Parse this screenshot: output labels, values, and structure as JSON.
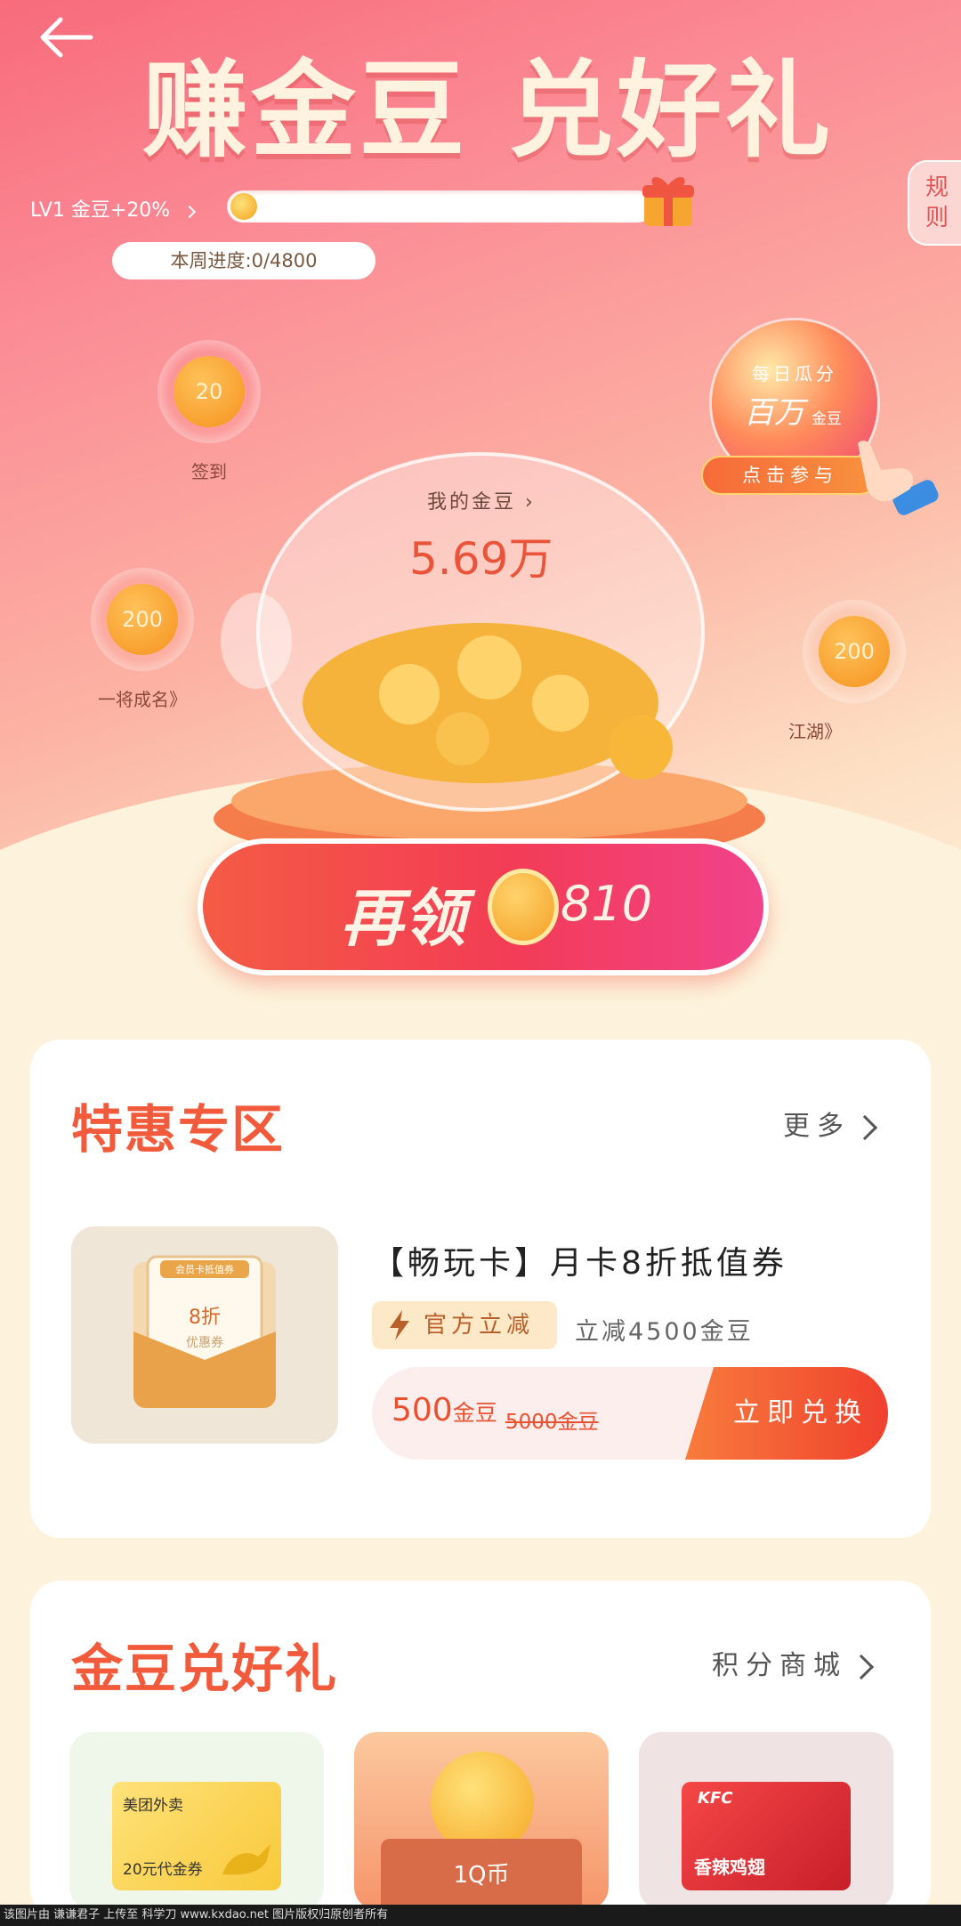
{
  "header": {
    "back_icon": "arrow-left-icon",
    "headline": "赚金豆 兑好礼",
    "rules_label": "规则"
  },
  "level": {
    "label": "LV1 金豆+20%",
    "week_progress": "本周进度:0/4800",
    "progress_fraction": 0.0
  },
  "bubbles": [
    {
      "value": "20",
      "label": "签到"
    },
    {
      "value": "200",
      "label": "一将成名》"
    },
    {
      "value": "200",
      "label": "江湖》"
    }
  ],
  "promo": {
    "line1": "每日瓜分",
    "line2": "百万",
    "line3": "金豆",
    "button": "点击参与"
  },
  "piggy": {
    "link_label": "我的金豆",
    "value": "5.69万"
  },
  "claim": {
    "label": "再领",
    "amount": "810"
  },
  "special_zone": {
    "title": "特惠专区",
    "more_label": "更多",
    "product": {
      "thumb_tag": "会员卡抵值券",
      "thumb_discount": "8折",
      "thumb_text": "优惠券",
      "title": "【畅玩卡】月卡8折抵值券",
      "badge": "官方立减",
      "discount_desc": "立减4500金豆",
      "price_value": "500",
      "price_unit": "金豆",
      "original_price": "5000金豆",
      "exchange_label": "立即兑换"
    }
  },
  "bean_gifts": {
    "title": "金豆兑好礼",
    "more_label": "积分商城",
    "items": [
      {
        "brand": "美团外卖",
        "text": "20元代金券"
      },
      {
        "text": "1Q币"
      },
      {
        "brand": "KFC",
        "text": "香辣鸡翅"
      }
    ]
  },
  "footer": {
    "watermark": "该图片由 谦谦君子 上传至 科学刀 www.kxdao.net 图片版权归原创者所有"
  },
  "colors": {
    "accent": "#f15a3a",
    "claim_button": "#f33c55",
    "background": "#fdf3dc"
  }
}
